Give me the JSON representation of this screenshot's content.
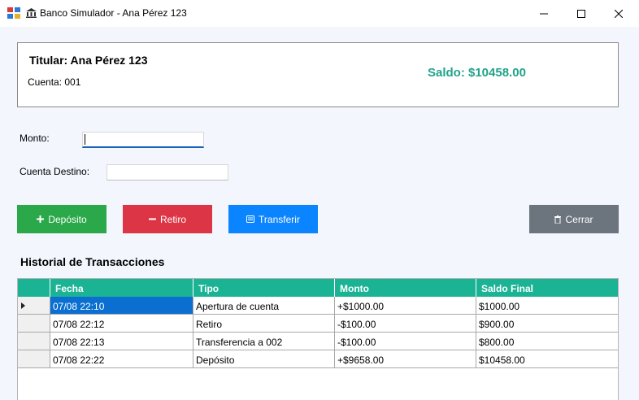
{
  "window": {
    "title": "Banco Simulador - Ana Pérez 123",
    "minimize_icon": "minimize-icon",
    "maximize_icon": "maximize-icon",
    "close_icon": "close-icon"
  },
  "account_panel": {
    "holder": "Titular: Ana Pérez 123",
    "account": "Cuenta: 001",
    "balance": "Saldo: $10458.00",
    "balance_color": "#20a38a"
  },
  "form": {
    "amount_label": "Monto:",
    "amount_value": "",
    "dest_label": "Cuenta Destino:",
    "dest_value": ""
  },
  "buttons": {
    "deposit": {
      "label": "Depósito",
      "icon": "plus-icon",
      "color": "#2aa84a"
    },
    "withdraw": {
      "label": "Retiro",
      "icon": "minus-icon",
      "color": "#dc3545"
    },
    "transfer": {
      "label": "Transferir",
      "icon": "transfer-icon",
      "color": "#0a84ff"
    },
    "close": {
      "label": "Cerrar",
      "icon": "trash-icon",
      "color": "#6c757d"
    }
  },
  "history": {
    "title": "Historial de Transacciones",
    "header_color": "#1ab394",
    "columns": [
      "Fecha",
      "Tipo",
      "Monto",
      "Saldo Final"
    ],
    "rows": [
      {
        "fecha": "07/08 22:10",
        "tipo": "Apertura de cuenta",
        "monto": "+$1000.00",
        "saldo": "$1000.00"
      },
      {
        "fecha": "07/08 22:12",
        "tipo": "Retiro",
        "monto": "-$100.00",
        "saldo": "$900.00"
      },
      {
        "fecha": "07/08 22:13",
        "tipo": "Transferencia a 002",
        "monto": "-$100.00",
        "saldo": "$800.00"
      },
      {
        "fecha": "07/08 22:22",
        "tipo": "Depósito",
        "monto": "+$9658.00",
        "saldo": "$10458.00"
      }
    ]
  }
}
